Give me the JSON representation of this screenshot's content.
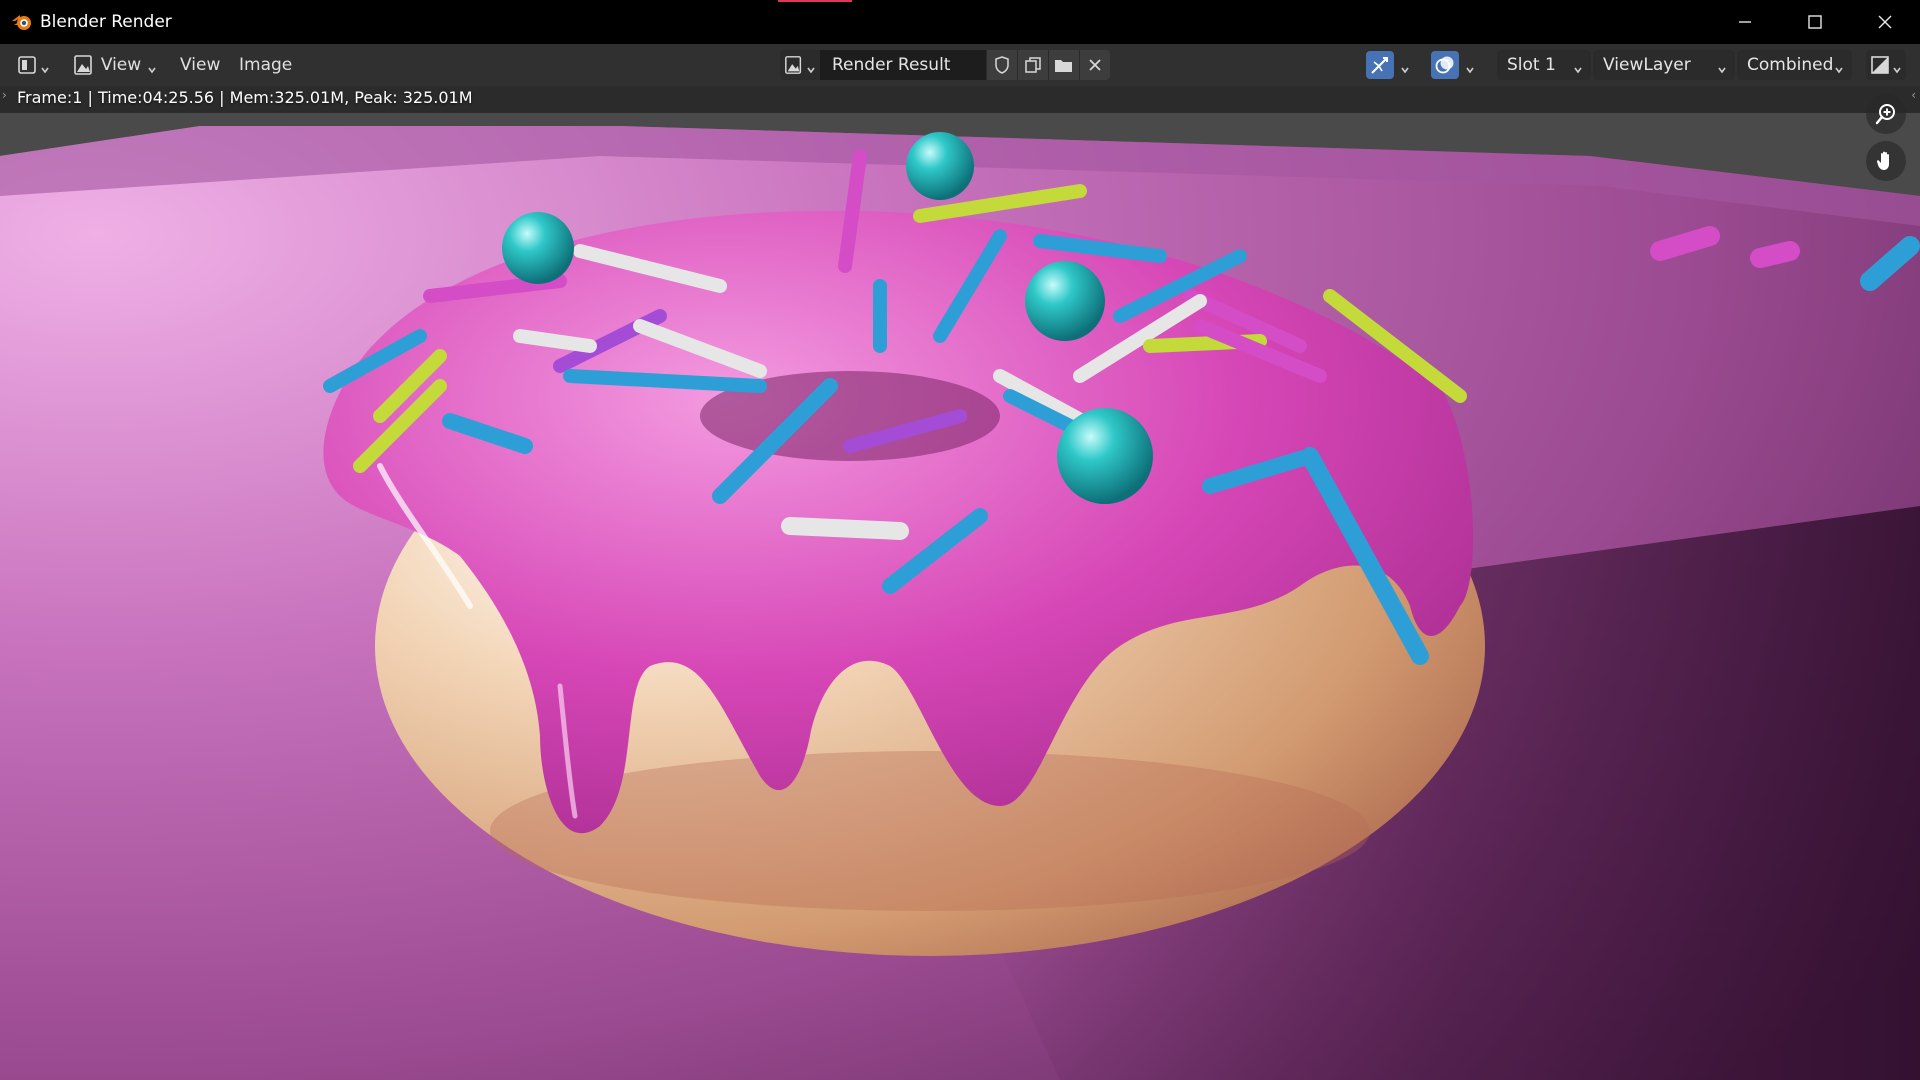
{
  "window": {
    "title": "Blender Render",
    "icons": {
      "app": "blender-logo-icon",
      "minimize": "minimize-icon",
      "maximize": "maximize-icon",
      "close": "close-icon"
    }
  },
  "header": {
    "editor_type_icon": "image-editor-icon",
    "mode_label": "View",
    "menus": [
      "View",
      "Image"
    ],
    "image_name": "Render Result",
    "image_actions": [
      "fake-user-shield-icon",
      "duplicate-icon",
      "open-folder-icon",
      "unlink-x-icon"
    ],
    "slot": "Slot 1",
    "view_layer": "ViewLayer",
    "pass": "Combined",
    "display_channels_icon": "display-channels-icon"
  },
  "viewport": {
    "status": "Frame:1 | Time:04:25.56 | Mem:325.01M, Peak: 325.01M",
    "nav_icons": [
      "zoom-icon",
      "pan-hand-icon"
    ]
  },
  "colors": {
    "titlebar": "#000000",
    "header": "#303030",
    "accent": "#4772b3",
    "background_pink": "#c46bb8",
    "icing": "#d63fb4",
    "dough": "#e8b78a"
  }
}
